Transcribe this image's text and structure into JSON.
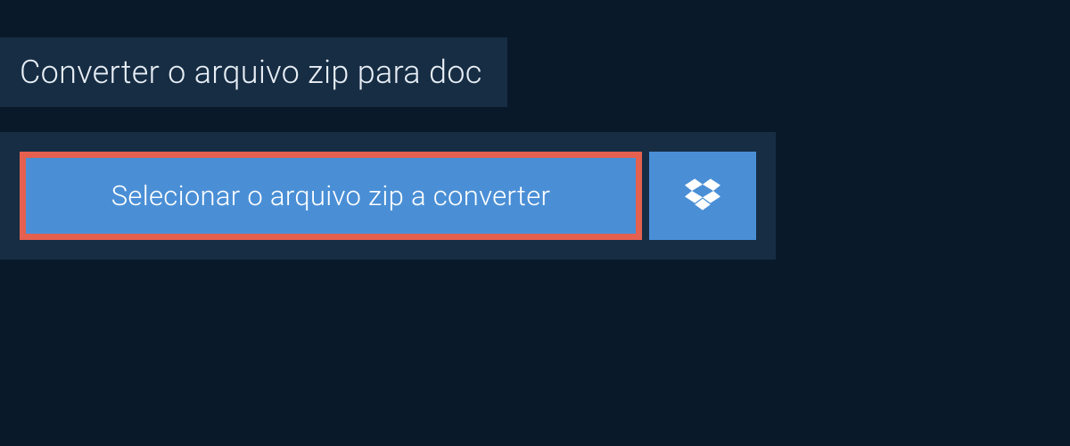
{
  "header": {
    "title": "Converter o arquivo zip para doc"
  },
  "actions": {
    "select_file_label": "Selecionar o arquivo zip a converter"
  }
}
